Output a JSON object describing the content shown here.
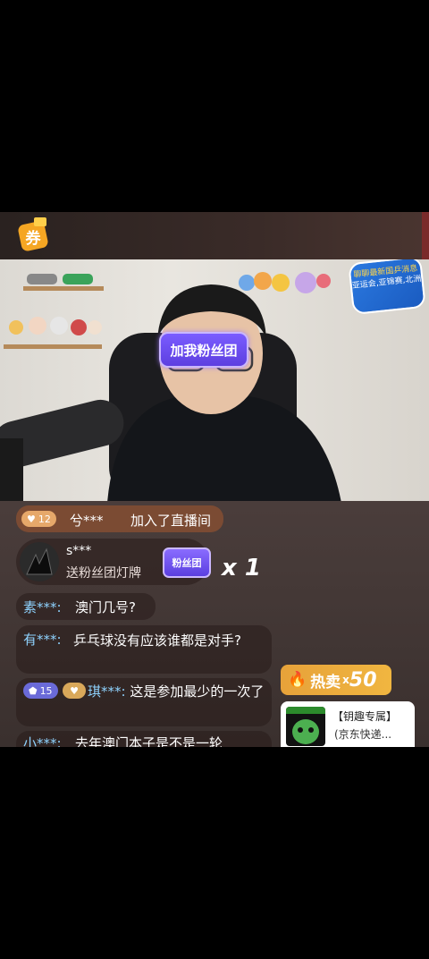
{
  "fan_club_badge": "加我粉丝团",
  "promo_badge": {
    "line1": "聊聊最新国乒消息",
    "line2": "亚运会,亚锦赛,北洲"
  },
  "join_notice": {
    "level": "12",
    "user": "兮***",
    "text": "加入了直播间"
  },
  "gift": {
    "user": "s***",
    "text": "送粉丝团灯牌",
    "badge": "粉丝团",
    "count": "x 1"
  },
  "messages": [
    {
      "user": "素***:",
      "text": "澳门几号?"
    },
    {
      "user": "有***:",
      "text": "乒乓球没有应该谁都是对手?"
    },
    {
      "level": "15",
      "user": "琪***:",
      "text": "这是参加最少的一次了"
    },
    {
      "user": "小***:",
      "text": "去年澳门本子是不是一轮"
    }
  ],
  "hot_sale": {
    "label": "热卖",
    "mult": "x",
    "count": "50"
  },
  "product": {
    "title": "【钥趣专属】",
    "subtitle": "(京东快递..."
  },
  "colors": {
    "accent": "#f0b640",
    "fan_purple": "#7a5cff",
    "name_blue": "#8fd3ff"
  }
}
